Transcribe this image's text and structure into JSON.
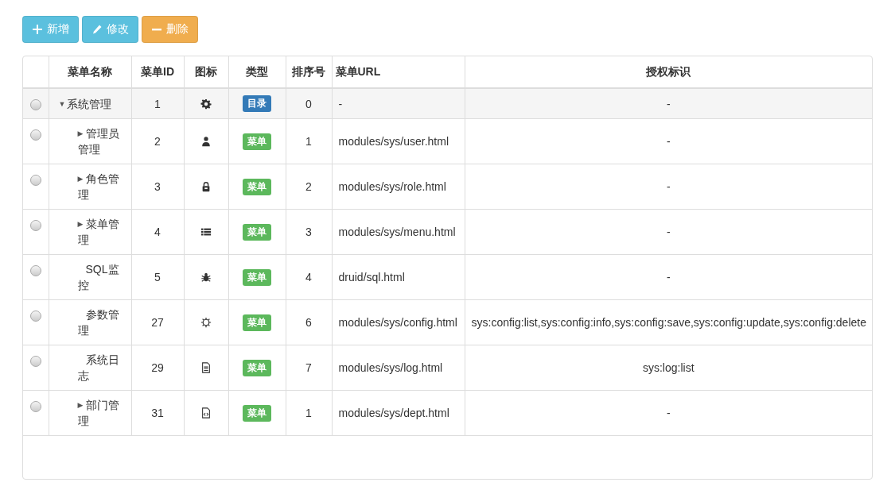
{
  "toolbar": [
    {
      "label": "新增",
      "kind": "add"
    },
    {
      "label": "修改",
      "kind": "edit"
    },
    {
      "label": "删除",
      "kind": "delete"
    }
  ],
  "table": {
    "columns": [
      "菜单名称",
      "菜单ID",
      "图标",
      "类型",
      "排序号",
      "菜单URL",
      "授权标识"
    ],
    "rows": [
      {
        "name": "系统管理",
        "id": "1",
        "icon": {
          "kind": "gear"
        },
        "type": {
          "label": "目录",
          "color": "#337ab7"
        },
        "order": "0",
        "url": "-",
        "perms": "-",
        "selected": false,
        "highlighted": true,
        "toggle": "▼",
        "children": [
          {
            "name": "管理员管理",
            "id": "2",
            "icon": {
              "kind": "user"
            },
            "type": {
              "label": "菜单",
              "color": "#5cb85c"
            },
            "order": "1",
            "url": "modules/sys/user.html",
            "perms": "-",
            "selected": false,
            "highlighted": false,
            "toggle": "▶"
          },
          {
            "name": "角色管理",
            "id": "3",
            "icon": {
              "kind": "role"
            },
            "type": {
              "label": "菜单",
              "color": "#5cb85c"
            },
            "order": "2",
            "url": "modules/sys/role.html",
            "perms": "-",
            "selected": false,
            "highlighted": false,
            "toggle": "▶"
          },
          {
            "name": "菜单管理",
            "id": "4",
            "icon": {
              "kind": "list"
            },
            "type": {
              "label": "菜单",
              "color": "#5cb85c"
            },
            "order": "3",
            "url": "modules/sys/menu.html",
            "perms": "-",
            "selected": false,
            "highlighted": false,
            "toggle": "▶"
          },
          {
            "name": "SQL监控",
            "id": "5",
            "icon": {
              "kind": "bug"
            },
            "type": {
              "label": "菜单",
              "color": "#5cb85c"
            },
            "order": "4",
            "url": "druid/sql.html",
            "perms": "-",
            "selected": false,
            "highlighted": false
          },
          {
            "name": "参数管理",
            "id": "27",
            "icon": {
              "kind": "sun"
            },
            "type": {
              "label": "菜单",
              "color": "#5cb85c"
            },
            "order": "6",
            "url": "modules/sys/config.html",
            "perms": "sys:config:list,sys:config:info,sys:config:save,sys:config:update,sys:config:delete",
            "selected": false,
            "highlighted": false
          },
          {
            "name": "系统日志",
            "id": "29",
            "icon": {
              "kind": "file"
            },
            "type": {
              "label": "菜单",
              "color": "#5cb85c"
            },
            "order": "7",
            "url": "modules/sys/log.html",
            "perms": "sys:log:list",
            "selected": false,
            "highlighted": false
          },
          {
            "name": "部门管理",
            "id": "31",
            "icon": {
              "kind": "code-file"
            },
            "type": {
              "label": "菜单",
              "color": "#5cb85c"
            },
            "order": "1",
            "url": "modules/sys/dept.html",
            "perms": "-",
            "selected": false,
            "highlighted": false,
            "toggle": "▶"
          }
        ]
      }
    ]
  }
}
